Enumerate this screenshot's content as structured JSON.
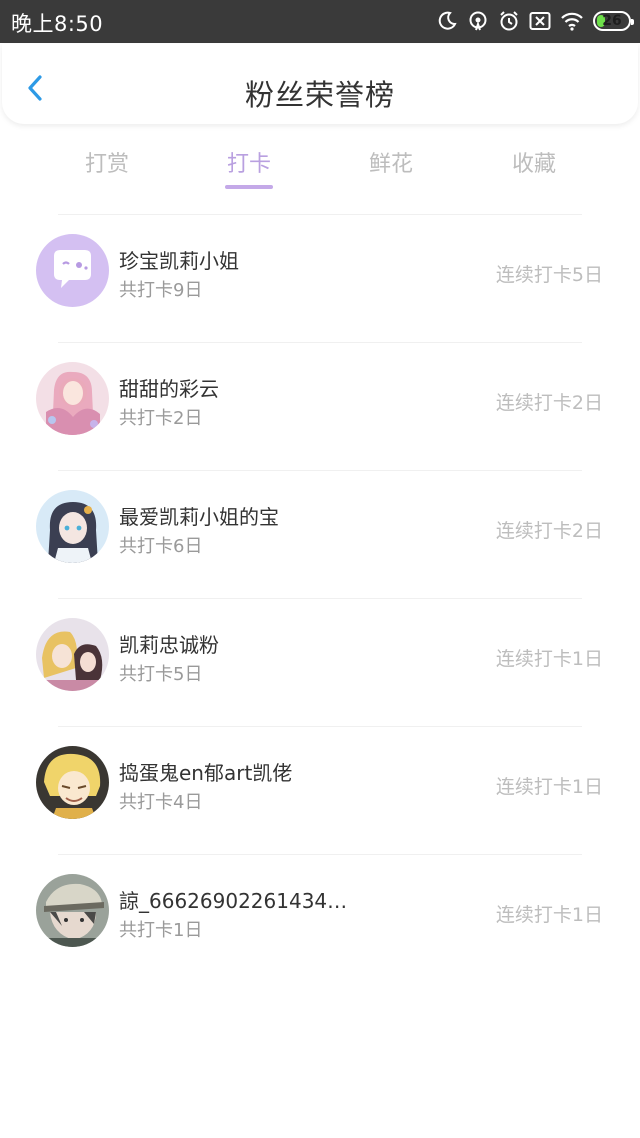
{
  "status_bar": {
    "time": "晚上8:50",
    "battery": "26"
  },
  "header": {
    "title": "粉丝荣誉榜"
  },
  "tabs": [
    {
      "label": "打赏",
      "active": false
    },
    {
      "label": "打卡",
      "active": true
    },
    {
      "label": "鲜花",
      "active": false
    },
    {
      "label": "收藏",
      "active": false
    }
  ],
  "colors": {
    "accent": "#c4a9e8",
    "muted": "#bdbdbd",
    "status_bar_bg": "#3a3a3a"
  },
  "fans": [
    {
      "name": "珍宝凯莉小姐",
      "total": "共打卡9日",
      "streak": "连续打卡5日",
      "avatar": "chat-bubble-avatar"
    },
    {
      "name": "甜甜的彩云",
      "total": "共打卡2日",
      "streak": "连续打卡2日",
      "avatar": "anime-girl-pink-avatar"
    },
    {
      "name": "最爱凯莉小姐的宝",
      "total": "共打卡6日",
      "streak": "连续打卡2日",
      "avatar": "anime-girl-dark-hair-avatar"
    },
    {
      "name": "凯莉忠诚粉",
      "total": "共打卡5日",
      "streak": "连续打卡1日",
      "avatar": "anime-couple-avatar"
    },
    {
      "name": "捣蛋鬼en郁art凯佬",
      "total": "共打卡4日",
      "streak": "连续打卡1日",
      "avatar": "anime-boy-blonde-avatar"
    },
    {
      "name": "諒_6662690226143401...",
      "total": "共打卡1日",
      "streak": "连续打卡1日",
      "avatar": "anime-boy-cap-avatar"
    }
  ]
}
